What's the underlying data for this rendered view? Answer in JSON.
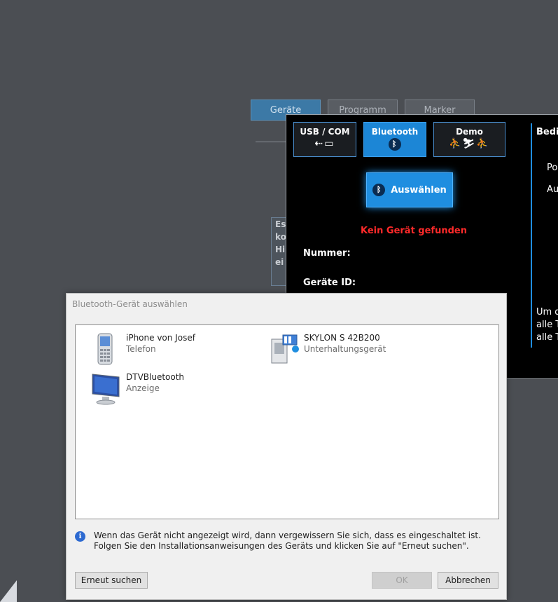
{
  "background_app": {
    "tabs": [
      "Geräte",
      "Programm",
      "Marker"
    ],
    "note_fragments": [
      "Es",
      "ko",
      "Hi",
      "ei"
    ]
  },
  "device_panel": {
    "tabs": [
      {
        "label": "USB / COM",
        "icon": "usb-com-icon"
      },
      {
        "label": "Bluetooth",
        "icon": "bluetooth-icon"
      },
      {
        "label": "Demo",
        "icon": "fitness-devices-icon"
      }
    ],
    "select_button": "Auswählen",
    "status": "Kein Gerät gefunden",
    "number_label": "Nummer:",
    "device_id_label": "Geräte ID:",
    "right": {
      "heading": "Bedi",
      "line1": "Po",
      "line2": "Au",
      "bottom1": "Um d",
      "bottom2": "alle T",
      "bottom3": "alle T"
    }
  },
  "dialog": {
    "title": "Bluetooth-Gerät auswählen",
    "devices": [
      {
        "name": "iPhone von Josef",
        "type": "Telefon",
        "icon": "phone-icon"
      },
      {
        "name": "SKYLON S 42B200",
        "type": "Unterhaltungsgerät",
        "icon": "media-device-icon"
      },
      {
        "name": "DTVBluetooth",
        "type": "Anzeige",
        "icon": "monitor-icon"
      }
    ],
    "info_text": "Wenn das Gerät nicht angezeigt wird, dann vergewissern Sie sich, dass es eingeschaltet ist. Folgen Sie den Installationsanweisungen des Geräts und klicken Sie auf \"Erneut suchen\".",
    "buttons": {
      "search_again": "Erneut suchen",
      "ok": "OK",
      "cancel": "Abbrechen"
    }
  }
}
